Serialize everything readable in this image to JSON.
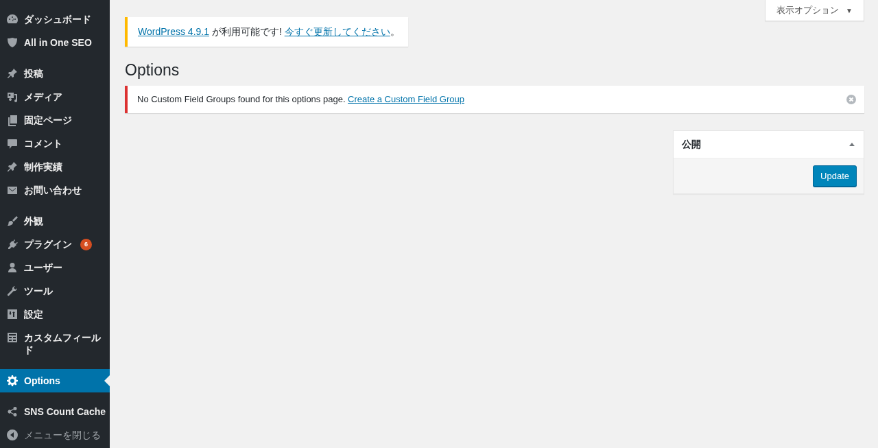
{
  "sidebar": {
    "groups": [
      [
        {
          "label": "ダッシュボード",
          "kind": "dashboard",
          "selected": false
        },
        {
          "label": "All in One SEO",
          "kind": "shield",
          "selected": false
        }
      ],
      [
        {
          "label": "投稿",
          "kind": "pin",
          "selected": false
        },
        {
          "label": "メディア",
          "kind": "media",
          "selected": false
        },
        {
          "label": "固定ページ",
          "kind": "pages",
          "selected": false
        },
        {
          "label": "コメント",
          "kind": "comment",
          "selected": false
        },
        {
          "label": "制作実績",
          "kind": "pin",
          "selected": false
        },
        {
          "label": "お問い合わせ",
          "kind": "mail",
          "selected": false
        }
      ],
      [
        {
          "label": "外観",
          "kind": "brush",
          "selected": false
        },
        {
          "label": "プラグイン",
          "kind": "plug",
          "selected": false,
          "badge": "6"
        },
        {
          "label": "ユーザー",
          "kind": "user",
          "selected": false
        },
        {
          "label": "ツール",
          "kind": "wrench",
          "selected": false
        },
        {
          "label": "設定",
          "kind": "sliders",
          "selected": false
        },
        {
          "label": "カスタムフィールド",
          "kind": "table",
          "selected": false
        }
      ],
      [
        {
          "label": "Options",
          "kind": "gear",
          "selected": true
        }
      ],
      [
        {
          "label": "SNS Count Cache",
          "kind": "share",
          "selected": false
        },
        {
          "label": "メニューを閉じる",
          "kind": "collapse",
          "selected": false
        }
      ]
    ]
  },
  "screen_options": {
    "label": "表示オプション",
    "caret": "▼"
  },
  "update_notice": {
    "parts": [
      {
        "kind": "link",
        "text": "WordPress 4.9.1"
      },
      {
        "kind": "text",
        "text": " が利用可能です! "
      },
      {
        "kind": "link",
        "text": "今すぐ更新してください"
      },
      {
        "kind": "text",
        "text": "。"
      }
    ]
  },
  "page_title": "Options",
  "error_notice": {
    "text": "No Custom Field Groups found for this options page.",
    "link": "Create a Custom Field Group"
  },
  "publish_box": {
    "title": "公開",
    "expanded": true,
    "button": "Update"
  }
}
